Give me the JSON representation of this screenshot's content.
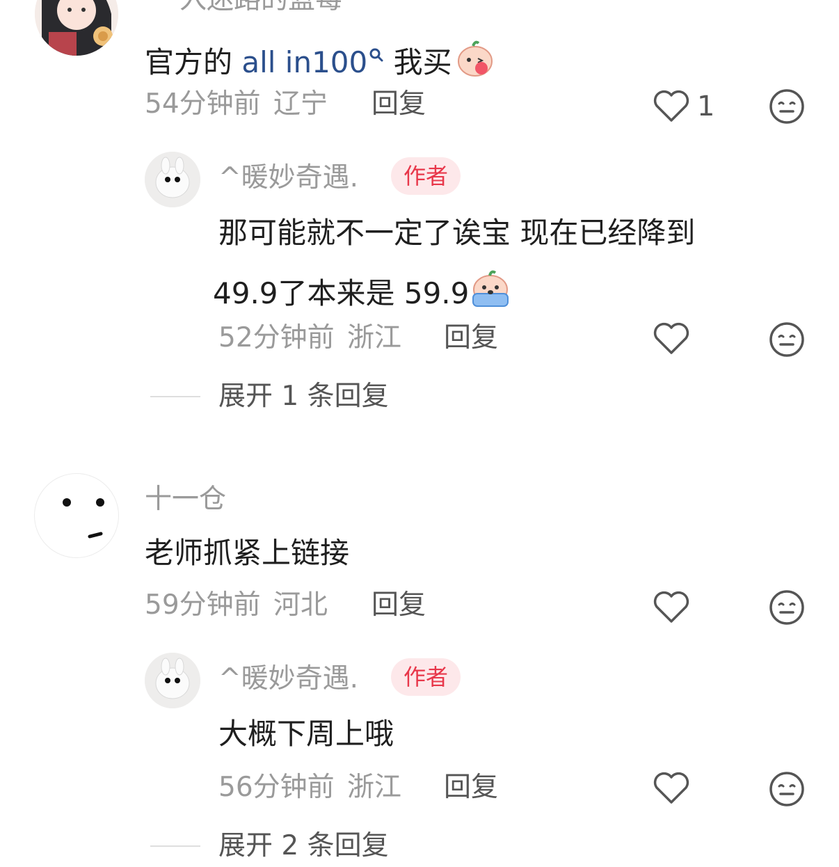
{
  "comment1": {
    "username": "入迷路的蓝莓",
    "text_prefix": "官方的 ",
    "link_text": "all in100",
    "text_suffix": " 我买",
    "time": "54分钟前",
    "location": "辽宁",
    "reply": "回复",
    "likes": "1"
  },
  "reply1": {
    "username": "^暖妙奇遇.",
    "badge": "作者",
    "line1": "那可能就不一定了诶宝 现在已经降到",
    "line2": " 49.9了本来是 59.9",
    "time": "52分钟前",
    "location": "浙江",
    "reply": "回复"
  },
  "expand1": "展开 1 条回复",
  "comment2": {
    "username": "十一仓",
    "text": "老师抓紧上链接",
    "time": "59分钟前",
    "location": "河北",
    "reply": "回复"
  },
  "reply2": {
    "username": "^暖妙奇遇.",
    "badge": "作者",
    "text": "大概下周上哦",
    "time": "56分钟前",
    "location": "浙江",
    "reply": "回复"
  },
  "expand2": "展开 2 条回复",
  "icons": {
    "like": "heart-outline-icon",
    "dislike": "meh-face-icon",
    "search": "search-icon"
  },
  "colors": {
    "author_badge_bg": "#fde8ea",
    "author_badge_text": "#e8374a",
    "link": "#2b4f8c",
    "meta": "#9a9a9a"
  }
}
